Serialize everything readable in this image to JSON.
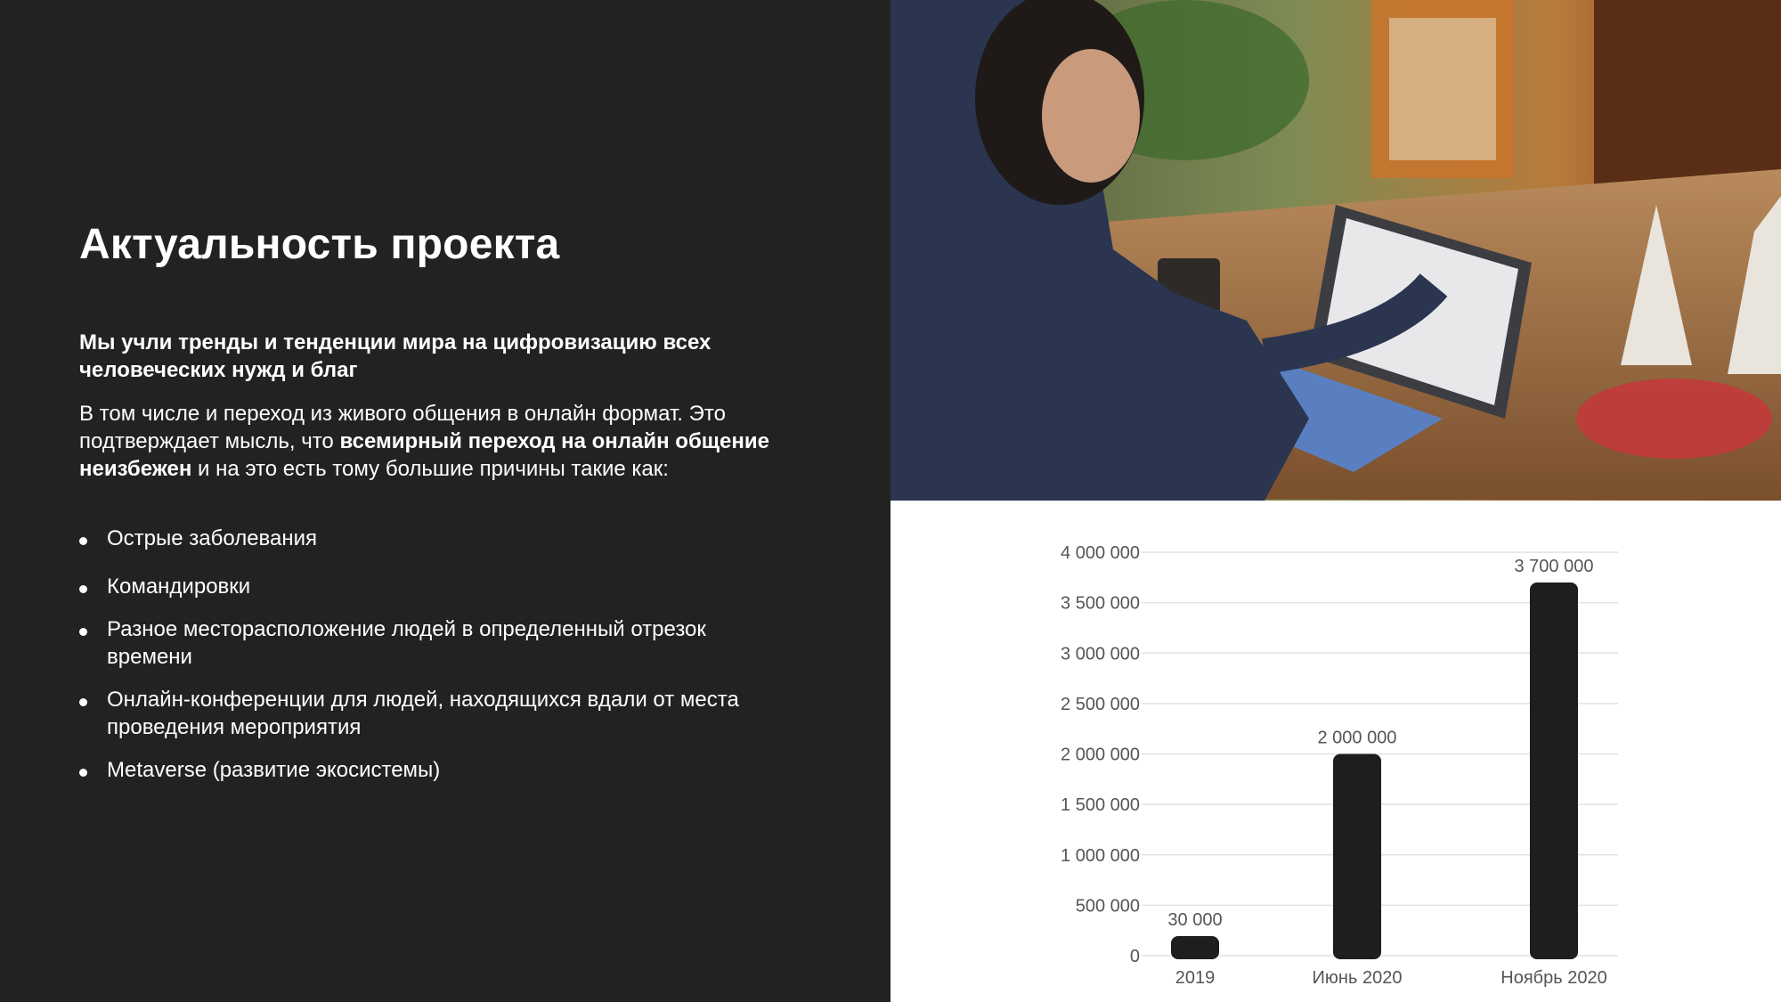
{
  "slide": {
    "title": "Актуальность проекта",
    "lead": "Мы учли тренды и тенденции мира на цифровизацию всех человеческих нужд и благ",
    "body_intro": "В том числе и переход из живого общения в онлайн формат. Это подтверждает мысль, что ",
    "body_bold": "всемирный переход на онлайн общение неизбежен",
    "body_outro": " и на это есть тому большие причины такие как:",
    "reasons": [
      "Острые заболевания",
      "Командировки",
      "Разное месторасположение людей в определенный отрезок времени",
      "Онлайн-конференции для людей, находящихся вдали от места проведения мероприятия",
      "Metaverse (развитие экосистемы)"
    ]
  },
  "colors": {
    "panel_background": "#222222",
    "panel_text": "#ffffff",
    "bar": "#1e1e1e",
    "gridline": "#e2e2e2",
    "axis_text": "#555555"
  },
  "chart_data": {
    "type": "bar",
    "categories": [
      "2019",
      "Июнь 2020",
      "Ноябрь 2020"
    ],
    "values": [
      30000,
      2000000,
      3700000
    ],
    "data_labels": [
      "30 000",
      "2 000 000",
      "3 700 000"
    ],
    "yticks": [
      0,
      500000,
      1000000,
      1500000,
      2000000,
      2500000,
      3000000,
      3500000,
      4000000
    ],
    "ytick_labels": [
      "0",
      "500 000",
      "1 000 000",
      "1 500 000",
      "2 000 000",
      "2 500 000",
      "3 000 000",
      "3 500 000",
      "4 000 000"
    ],
    "ylim": [
      0,
      4000000
    ],
    "grid": true,
    "title": "",
    "xlabel": "",
    "ylabel": ""
  }
}
